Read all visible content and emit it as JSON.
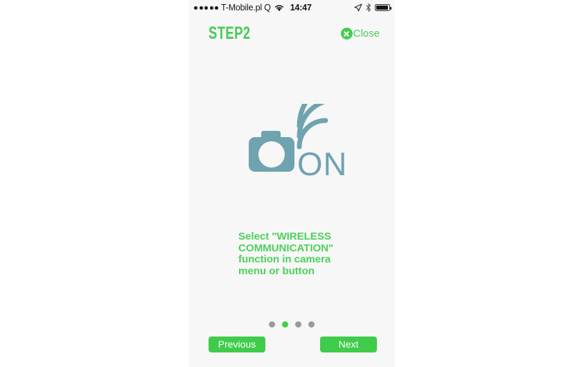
{
  "status_bar": {
    "signal_dots": 5,
    "carrier": "T-Mobile.pl Q",
    "wifi_icon": "wifi-icon",
    "time": "14:47",
    "location_icon": "location-arrow-icon",
    "bluetooth_icon": "bluetooth-icon",
    "battery_icon": "battery-icon"
  },
  "header": {
    "step_title": "STEP2",
    "close_label": "Close",
    "close_icon": "close-circle-icon"
  },
  "illustration": {
    "camera_icon": "camera-icon",
    "wireless_icon": "wireless-signal-icon",
    "on_label": "ON",
    "color": "#6fa3b0"
  },
  "instruction": {
    "text": "Select \"WIRELESS COMMUNICATION\"\nfunction in camera\nmenu or button"
  },
  "pagination": {
    "total": 4,
    "active_index": 1,
    "active_color": "#3fd241",
    "inactive_color": "#9a9a9a"
  },
  "nav": {
    "previous_label": "Previous",
    "next_label": "Next",
    "button_color": "#3fcc4b"
  },
  "theme": {
    "accent_green": "#45cd50",
    "screen_background": "#f7f7f7",
    "page_background": "#ffffff"
  }
}
